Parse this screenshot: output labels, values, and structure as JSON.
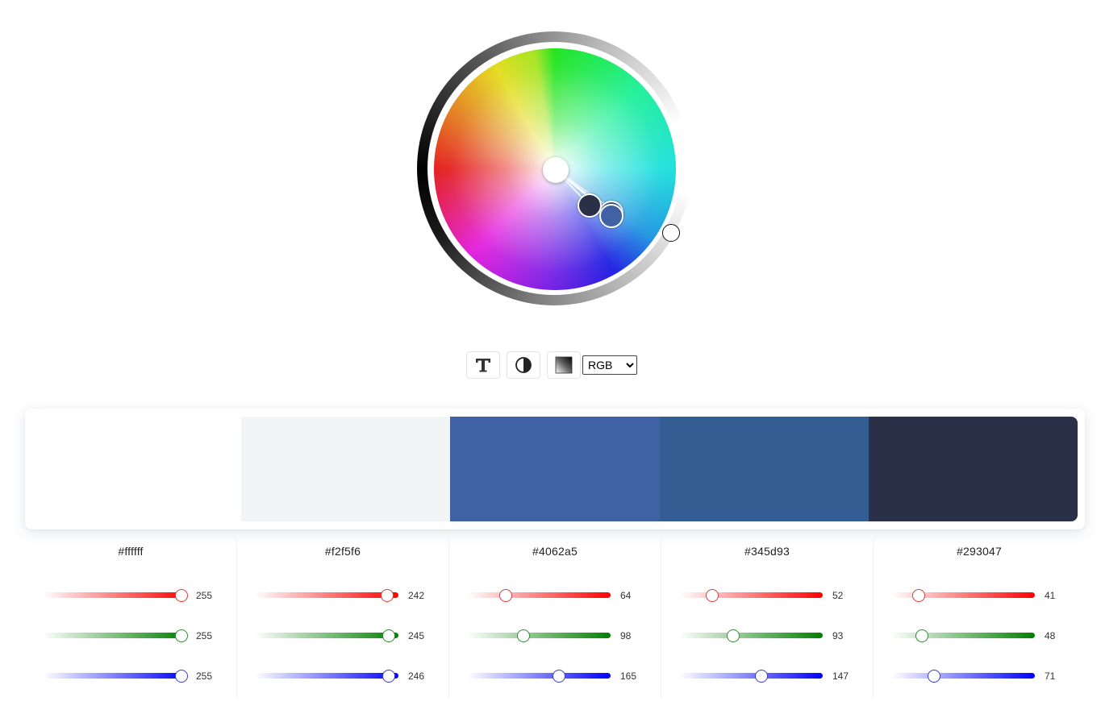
{
  "toolbar": {
    "buttons": [
      {
        "icon": "text-icon"
      },
      {
        "icon": "contrast-icon"
      },
      {
        "icon": "gradient-icon"
      }
    ],
    "mode_select": {
      "selected": "RGB",
      "options": [
        "RGB"
      ]
    }
  },
  "palette": [
    {
      "hex": "#ffffff",
      "r": 255,
      "g": 255,
      "b": 255
    },
    {
      "hex": "#f2f5f6",
      "r": 242,
      "g": 245,
      "b": 246
    },
    {
      "hex": "#4062a5",
      "r": 64,
      "g": 98,
      "b": 165
    },
    {
      "hex": "#345d93",
      "r": 52,
      "g": 93,
      "b": 147
    },
    {
      "hex": "#293047",
      "r": 41,
      "g": 48,
      "b": 71
    }
  ],
  "colors": {
    "red_channel": "#ff0000",
    "green_channel": "#008000",
    "blue_channel": "#0000ff"
  }
}
